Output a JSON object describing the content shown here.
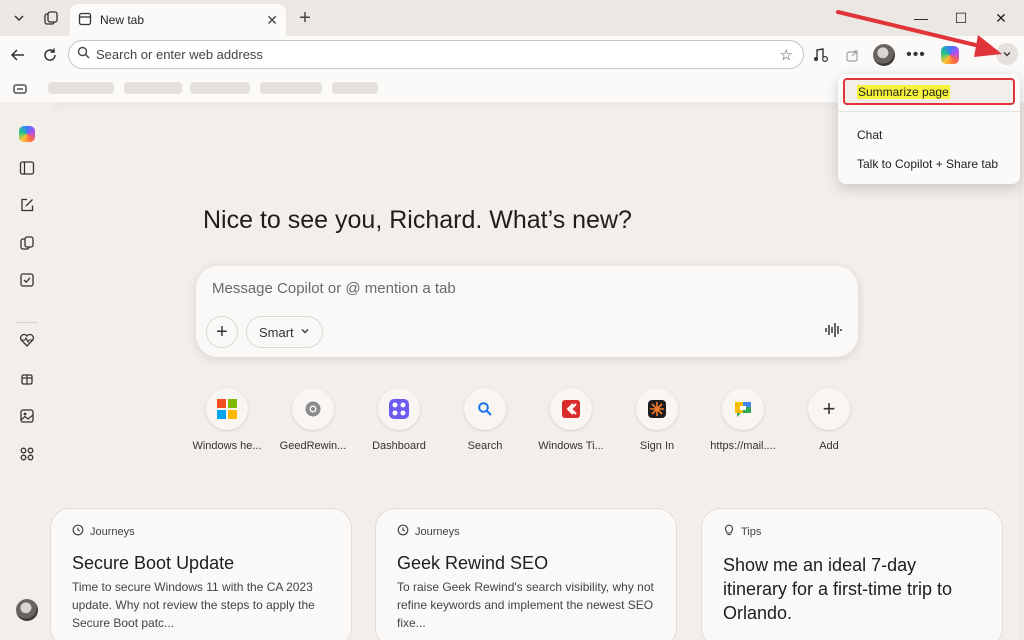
{
  "tabstrip": {
    "tab_title": "New tab",
    "close_glyph": "✕",
    "new_tab_glyph": "+",
    "window_controls": {
      "minimize": "—",
      "maximize": "☐",
      "close": "✕"
    }
  },
  "toolbar": {
    "address_placeholder": "Search or enter web address"
  },
  "composer": {
    "greeting": "Nice to see you, Richard. What’s new?",
    "placeholder": "Message Copilot or @ mention a tab",
    "mode": "Smart"
  },
  "shortcuts": [
    {
      "label": "Windows he...",
      "icon": "microsoft-logo"
    },
    {
      "label": "GeedRewin...",
      "icon": "chrome-like-icon"
    },
    {
      "label": "Dashboard",
      "icon": "dashboard-app-icon"
    },
    {
      "label": "Search",
      "icon": "search-icon"
    },
    {
      "label": "Windows Ti...",
      "icon": "windows-tips-icon"
    },
    {
      "label": "Sign In",
      "icon": "sign-in-icon"
    },
    {
      "label": "https://mail....",
      "icon": "mail-app-icon"
    },
    {
      "label": "Add",
      "icon": "plus-icon"
    }
  ],
  "cards": [
    {
      "tag": "Journeys",
      "title": "Secure Boot Update",
      "body": "Time to secure Windows 11 with the CA 2023 update. Why not review the steps to apply the Secure Boot patc..."
    },
    {
      "tag": "Journeys",
      "title": "Geek Rewind SEO",
      "body": "To raise Geek Rewind's search visibility, why not refine keywords and implement the newest SEO fixe..."
    },
    {
      "tag": "Tips",
      "title": "Show me an ideal 7-day itinerary for a first-time trip to Orlando.",
      "body": ""
    }
  ],
  "menu": {
    "items": [
      "Summarize page",
      "Chat",
      "Talk to Copilot + Share tab"
    ]
  },
  "colors": {
    "annotation": "#e0343a",
    "highlight": "#f7f33a",
    "microsoft": [
      "#f25022",
      "#7fba00",
      "#00a4ef",
      "#ffb900"
    ]
  }
}
